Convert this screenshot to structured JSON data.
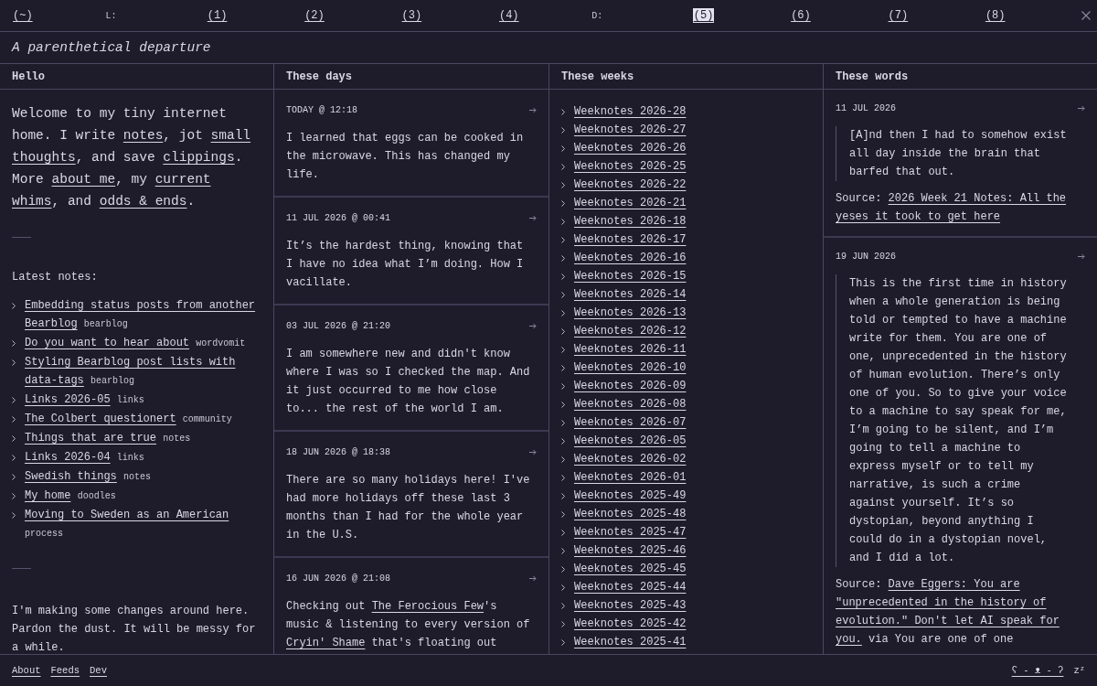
{
  "nav": {
    "items": [
      {
        "kind": "link",
        "label": "(~)",
        "selected": false
      },
      {
        "kind": "label",
        "label": "L:"
      },
      {
        "kind": "link",
        "label": "(1)",
        "selected": false
      },
      {
        "kind": "link",
        "label": "(2)",
        "selected": false
      },
      {
        "kind": "link",
        "label": "(3)",
        "selected": false
      },
      {
        "kind": "link",
        "label": "(4)",
        "selected": false
      },
      {
        "kind": "label",
        "label": "D:"
      },
      {
        "kind": "link",
        "label": "(5)",
        "selected": true
      },
      {
        "kind": "link",
        "label": "(6)",
        "selected": false
      },
      {
        "kind": "link",
        "label": "(7)",
        "selected": false
      },
      {
        "kind": "link",
        "label": "(8)",
        "selected": false
      }
    ]
  },
  "title": "A parenthetical departure",
  "columns": [
    {
      "kind": "home",
      "heading": "Hello",
      "intro": [
        {
          "kind": "text",
          "text": "Welcome to my tiny internet home. I write "
        },
        {
          "kind": "link",
          "text": "notes"
        },
        {
          "kind": "text",
          "text": ", jot "
        },
        {
          "kind": "link",
          "text": "small thoughts"
        },
        {
          "kind": "text",
          "text": ", and save "
        },
        {
          "kind": "link",
          "text": "clippings"
        },
        {
          "kind": "text",
          "text": ". More "
        },
        {
          "kind": "link",
          "text": "about me"
        },
        {
          "kind": "text",
          "text": ", my "
        },
        {
          "kind": "link",
          "text": "current whims"
        },
        {
          "kind": "text",
          "text": ", and "
        },
        {
          "kind": "link",
          "text": "odds & ends"
        },
        {
          "kind": "text",
          "text": "."
        }
      ],
      "notes_label": "Latest notes:",
      "notes": [
        {
          "title": "Embedding status posts from another Bearblog",
          "tag": "bearblog"
        },
        {
          "title": "Do you want to hear about",
          "tag": "wordvomit"
        },
        {
          "title": "Styling Bearblog post lists with data-tags",
          "tag": "bearblog"
        },
        {
          "title": "Links 2026-05",
          "tag": "links"
        },
        {
          "title": "The Colbert questionert",
          "tag": "community"
        },
        {
          "title": "Things that are true",
          "tag": "notes"
        },
        {
          "title": "Links 2026-04",
          "tag": "links"
        },
        {
          "title": "Swedish things",
          "tag": "notes"
        },
        {
          "title": "My home",
          "tag": "doodles"
        },
        {
          "title": "Moving to Sweden as an American",
          "tag": "process"
        }
      ],
      "notice": "I'm making some changes around here. Pardon the dust. It will be messy for a while."
    },
    {
      "kind": "posts",
      "heading": "These days",
      "posts": [
        {
          "date": "TODAY @ 12:18",
          "body": [
            {
              "kind": "text",
              "text": "I learned that eggs can be cooked in the microwave. This has changed my life."
            }
          ]
        },
        {
          "date": "11 JUL 2026 @ 00:41",
          "body": [
            {
              "kind": "text",
              "text": "It’s the hardest thing, knowing that I have no idea what I’m doing. How I vacillate."
            }
          ]
        },
        {
          "date": "03 JUL 2026 @ 21:20",
          "body": [
            {
              "kind": "text",
              "text": "I am somewhere new and didn't know where I was so I checked the map. And it just occurred to me how close to... the rest of the world I am."
            }
          ]
        },
        {
          "date": "18 JUN 2026 @ 18:38",
          "body": [
            {
              "kind": "text",
              "text": "There are so many holidays here! I've had more holidays off these last 3 months than I had for the whole year in the U.S."
            }
          ]
        },
        {
          "date": "16 JUN 2026 @ 21:08",
          "body": [
            {
              "kind": "text",
              "text": "Checking out "
            },
            {
              "kind": "link",
              "text": "The Ferocious Few"
            },
            {
              "kind": "text",
              "text": "'s music & listening to every version of "
            },
            {
              "kind": "link",
              "text": "Cryin' Shame"
            },
            {
              "kind": "text",
              "text": " that's floating out"
            }
          ]
        }
      ]
    },
    {
      "kind": "weeks",
      "heading": "These weeks",
      "weeks": [
        "Weeknotes 2026-28",
        "Weeknotes 2026-27",
        "Weeknotes 2026-26",
        "Weeknotes 2026-25",
        "Weeknotes 2026-22",
        "Weeknotes 2026-21",
        "Weeknotes 2026-18",
        "Weeknotes 2026-17",
        "Weeknotes 2026-16",
        "Weeknotes 2026-15",
        "Weeknotes 2026-14",
        "Weeknotes 2026-13",
        "Weeknotes 2026-12",
        "Weeknotes 2026-11",
        "Weeknotes 2026-10",
        "Weeknotes 2026-09",
        "Weeknotes 2026-08",
        "Weeknotes 2026-07",
        "Weeknotes 2026-05",
        "Weeknotes 2026-02",
        "Weeknotes 2026-01",
        "Weeknotes 2025-49",
        "Weeknotes 2025-48",
        "Weeknotes 2025-47",
        "Weeknotes 2025-46",
        "Weeknotes 2025-45",
        "Weeknotes 2025-44",
        "Weeknotes 2025-43",
        "Weeknotes 2025-42",
        "Weeknotes 2025-41"
      ]
    },
    {
      "kind": "words",
      "heading": "These words",
      "clippings": [
        {
          "date": "11 JUL 2026",
          "quote": "[A]nd then I had to somehow exist all day inside the brain that barfed that out.",
          "source": [
            {
              "kind": "text",
              "text": "Source: "
            },
            {
              "kind": "link",
              "text": "2026 Week 21 Notes: All the yeses it took to get here"
            }
          ]
        },
        {
          "date": "19 JUN 2026",
          "quote": "This is the first time in history when a whole generation is being told or tempted to have a machine write for them. You are one of one, unprecedented in the history of human evolution. There’s only one of you. So to give your voice to a machine to say speak for me, I’m going to be silent, and I’m going to tell a machine to express myself or to tell my narrative, is such a crime against yourself. It’s so dystopian, beyond anything I could do in a dystopian novel, and I did a lot.",
          "source": [
            {
              "kind": "text",
              "text": "Source: "
            },
            {
              "kind": "link",
              "text": "Dave Eggers: You are \"unprecedented in the history of evolution.\" Don't let AI speak for you."
            },
            {
              "kind": "text",
              "text": " via You are one of one"
            }
          ]
        }
      ]
    }
  ],
  "footer": {
    "links": [
      "About",
      "Feeds",
      "Dev"
    ],
    "mascot": "ʕ - ᴥ - ʔ",
    "sleep": "zᶻ"
  }
}
